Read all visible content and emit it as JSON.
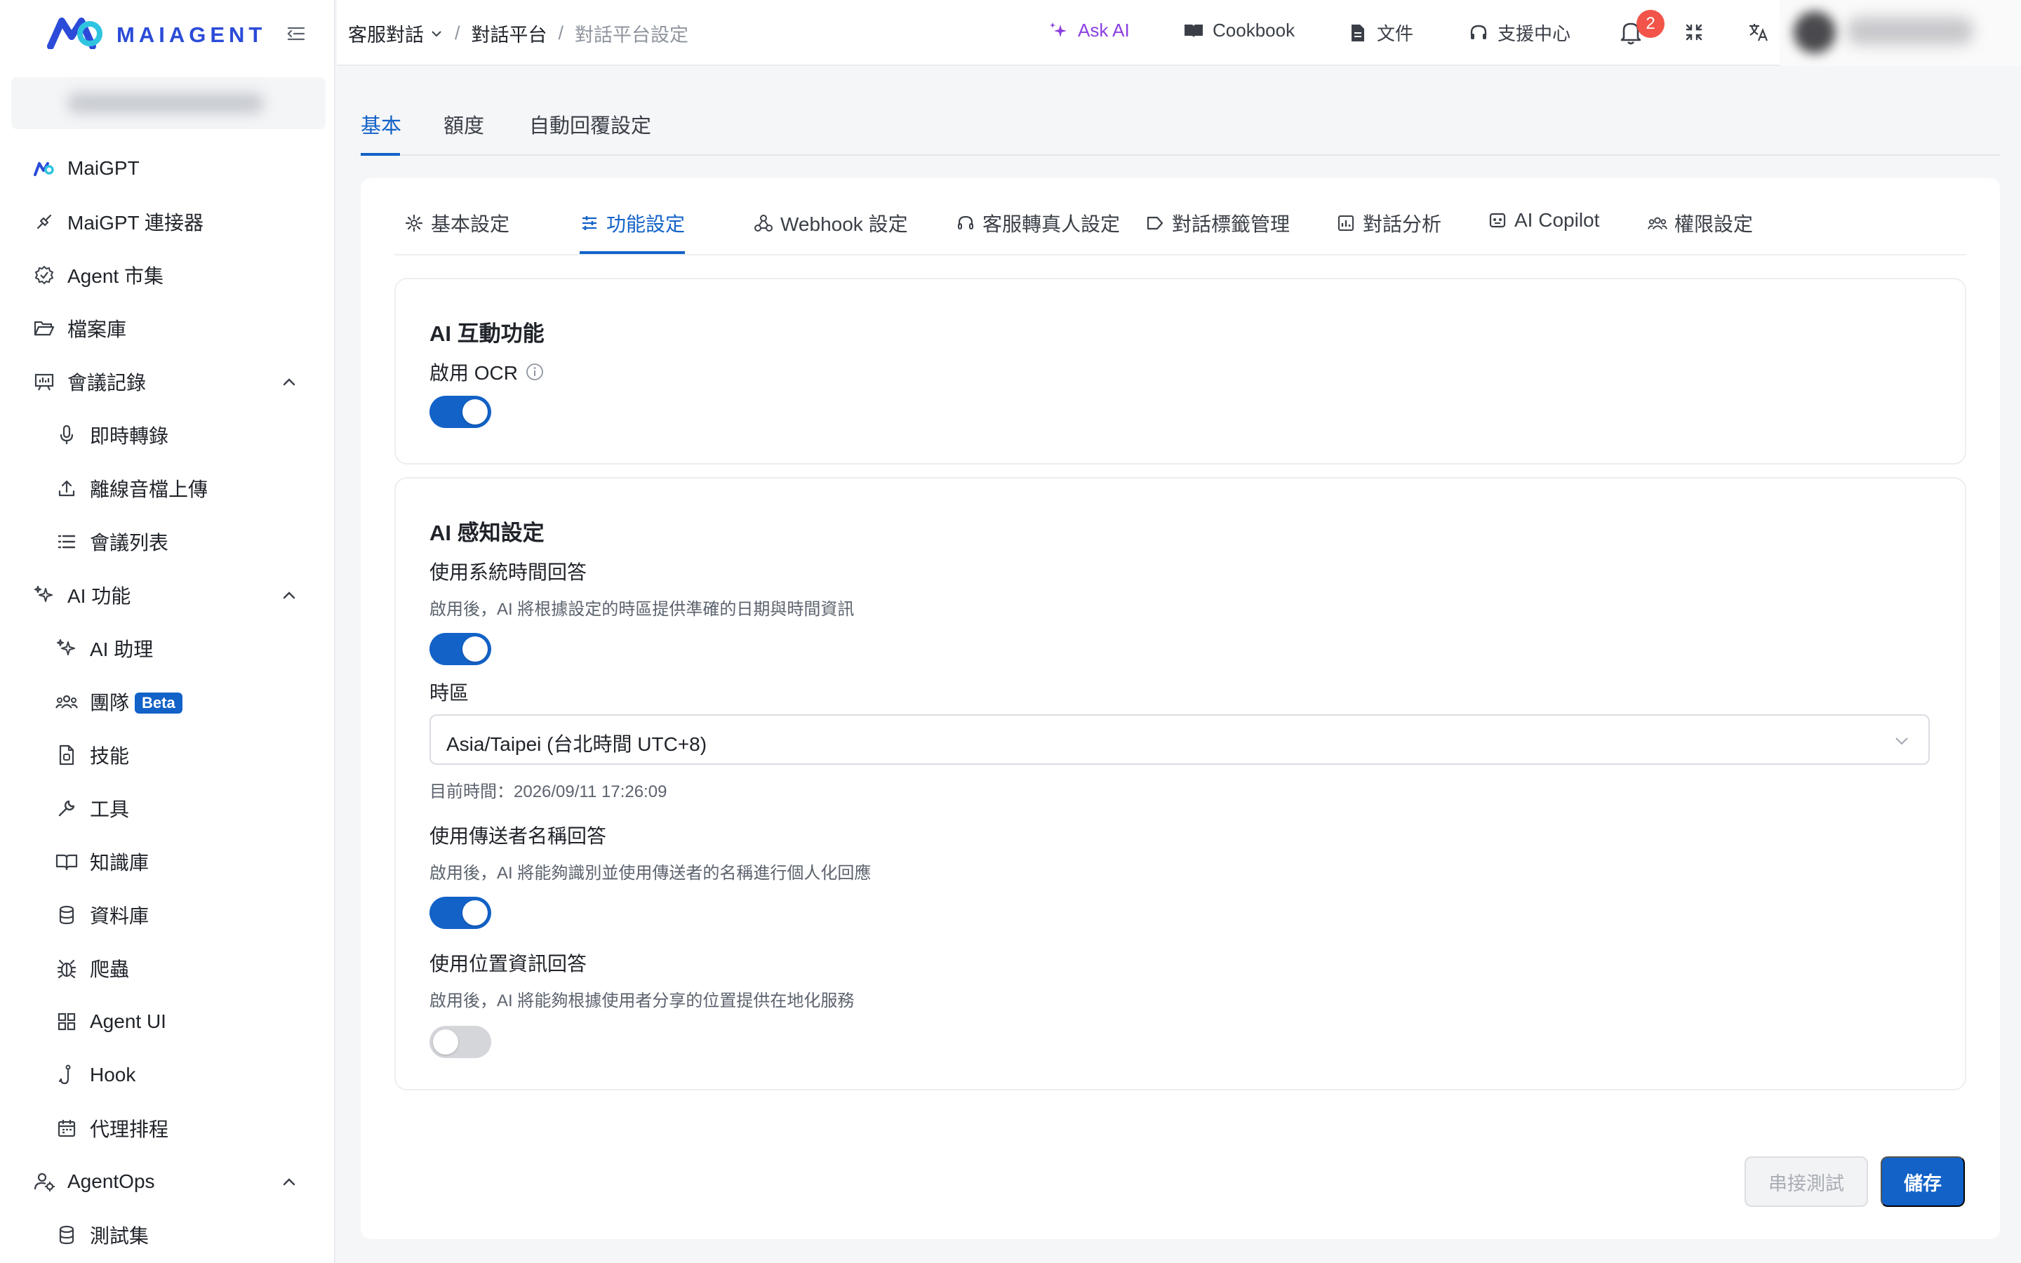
{
  "brand": {
    "name": "MAIAGENT",
    "color": "#2b4bd8"
  },
  "sidebar": {
    "items": [
      {
        "label": "MaiGPT",
        "icon": "maigpt-logo-icon",
        "level": 0
      },
      {
        "label": "MaiGPT 連接器",
        "icon": "connector-icon",
        "level": 0
      },
      {
        "label": "Agent 市集",
        "icon": "verified-badge-icon",
        "level": 0
      },
      {
        "label": "檔案庫",
        "icon": "folder-open-icon",
        "level": 0
      },
      {
        "label": "會議記錄",
        "icon": "presentation-icon",
        "level": 0,
        "expanded": true
      },
      {
        "label": "即時轉錄",
        "icon": "microphone-icon",
        "level": 1
      },
      {
        "label": "離線音檔上傳",
        "icon": "upload-icon",
        "level": 1
      },
      {
        "label": "會議列表",
        "icon": "list-icon",
        "level": 1
      },
      {
        "label": "AI 功能",
        "icon": "sparkles-icon",
        "level": 0,
        "expanded": true
      },
      {
        "label": "AI 助理",
        "icon": "sparkles-icon",
        "level": 1
      },
      {
        "label": "團隊",
        "icon": "team-icon",
        "level": 1,
        "badge": "Beta"
      },
      {
        "label": "技能",
        "icon": "skill-file-icon",
        "level": 1
      },
      {
        "label": "工具",
        "icon": "wrench-icon",
        "level": 1
      },
      {
        "label": "知識庫",
        "icon": "book-open-icon",
        "level": 1
      },
      {
        "label": "資料庫",
        "icon": "database-icon",
        "level": 1
      },
      {
        "label": "爬蟲",
        "icon": "bug-icon",
        "level": 1
      },
      {
        "label": "Agent UI",
        "icon": "grid-icon",
        "level": 1
      },
      {
        "label": "Hook",
        "icon": "hook-icon",
        "level": 1
      },
      {
        "label": "代理排程",
        "icon": "calendar-icon",
        "level": 1
      },
      {
        "label": "AgentOps",
        "icon": "user-gear-icon",
        "level": 0,
        "expanded": true
      },
      {
        "label": "測試集",
        "icon": "database-icon",
        "level": 1
      }
    ]
  },
  "topbar": {
    "breadcrumb": [
      "客服對話",
      "對話平台",
      "對話平台設定"
    ],
    "ask_ai": "Ask AI",
    "cookbook": "Cookbook",
    "docs": "文件",
    "support": "支援中心",
    "notification_count": "2"
  },
  "main_tabs": [
    "基本",
    "額度",
    "自動回覆設定"
  ],
  "active_main_tab": "基本",
  "sub_tabs": [
    {
      "label": "基本設定",
      "icon": "gear-icon"
    },
    {
      "label": "功能設定",
      "icon": "sliders-icon"
    },
    {
      "label": "Webhook 設定",
      "icon": "webhook-icon"
    },
    {
      "label": "客服轉真人設定",
      "icon": "headset-icon"
    },
    {
      "label": "對話標籤管理",
      "icon": "tag-icon"
    },
    {
      "label": "對話分析",
      "icon": "bar-chart-icon"
    },
    {
      "label": "AI Copilot",
      "icon": "copilot-icon"
    },
    {
      "label": "權限設定",
      "icon": "users-icon"
    }
  ],
  "active_sub_tab": "功能設定",
  "ai_interaction": {
    "title": "AI 互動功能",
    "ocr_label": "啟用 OCR",
    "ocr_enabled": true
  },
  "ai_perception": {
    "title": "AI 感知設定",
    "system_time": {
      "label": "使用系統時間回答",
      "desc": "啟用後，AI 將根據設定的時區提供準確的日期與時間資訊",
      "enabled": true
    },
    "timezone": {
      "label": "時區",
      "value": "Asia/Taipei (台北時間 UTC+8)",
      "current_time": "目前時間：2026/09/11 17:26:09"
    },
    "sender_name": {
      "label": "使用傳送者名稱回答",
      "desc": "啟用後，AI 將能夠識別並使用傳送者的名稱進行個人化回應",
      "enabled": true
    },
    "location": {
      "label": "使用位置資訊回答",
      "desc": "啟用後，AI 將能夠根據使用者分享的位置提供在地化服務",
      "enabled": false
    }
  },
  "actions": {
    "test": "串接測試",
    "save": "儲存"
  },
  "colors": {
    "primary": "#1262c8",
    "ask_ai": "#8b3fe0",
    "badge": "#f2544a"
  }
}
